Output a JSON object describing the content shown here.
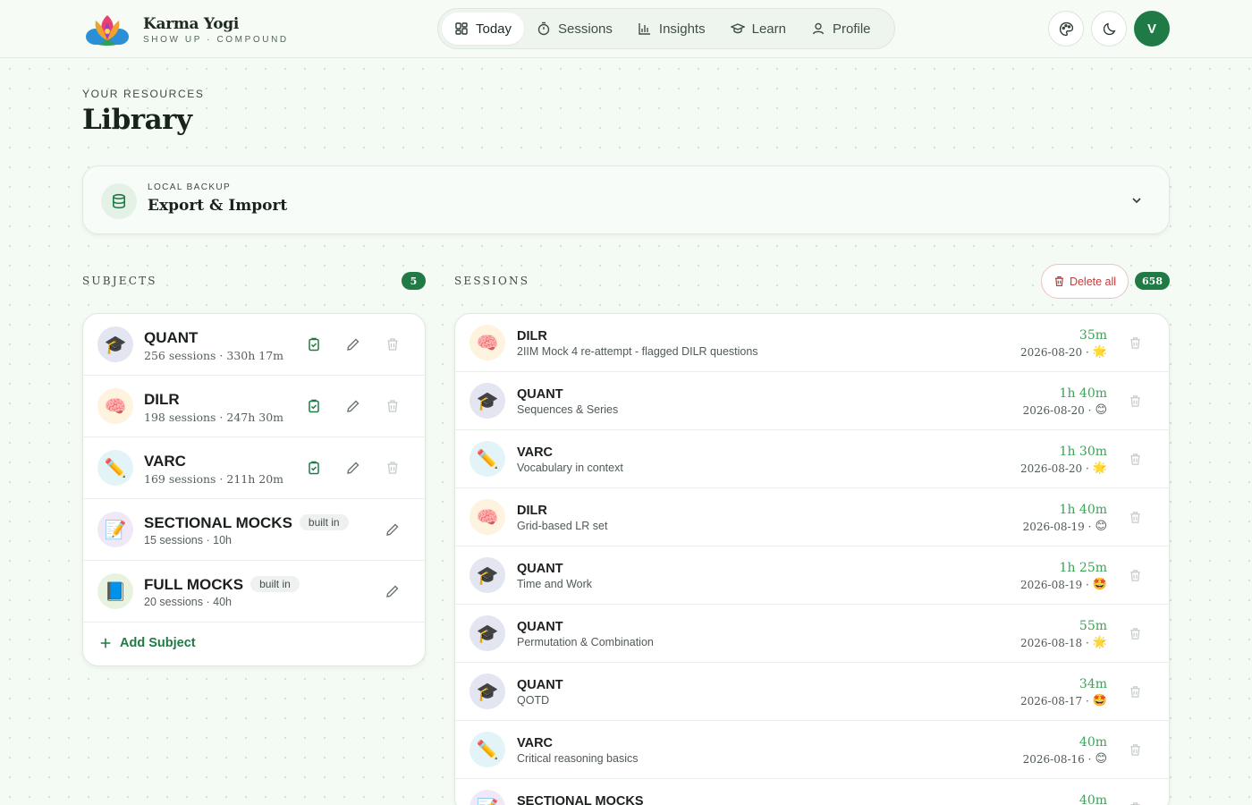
{
  "brand": {
    "name": "Karma Yogi",
    "tagline": "SHOW UP · COMPOUND"
  },
  "nav": {
    "items": [
      {
        "label": "Today",
        "icon": "grid-icon",
        "active": true
      },
      {
        "label": "Sessions",
        "icon": "timer-icon",
        "active": false
      },
      {
        "label": "Insights",
        "icon": "bar-chart-icon",
        "active": false
      },
      {
        "label": "Learn",
        "icon": "graduation-cap-icon",
        "active": false
      },
      {
        "label": "Profile",
        "icon": "user-icon",
        "active": false
      }
    ]
  },
  "toolbar": {
    "theme_icon": "palette-icon",
    "mode_icon": "moon-icon",
    "avatar_initial": "V"
  },
  "header": {
    "eyebrow": "YOUR RESOURCES",
    "title": "Library"
  },
  "backup": {
    "eyebrow": "LOCAL BACKUP",
    "title": "Export & Import"
  },
  "subjects": {
    "label": "SUBJECTS",
    "count": "5",
    "add_label": "Add Subject",
    "items": [
      {
        "name": "QUANT",
        "meta": "256 sessions · 330h 17m",
        "emoji": "🎓",
        "builtin": ""
      },
      {
        "name": "DILR",
        "meta": "198 sessions · 247h 30m",
        "emoji": "🧠",
        "builtin": ""
      },
      {
        "name": "VARC",
        "meta": "169 sessions · 211h 20m",
        "emoji": "✏️",
        "builtin": ""
      },
      {
        "name": "SECTIONAL MOCKS",
        "meta": "15 sessions · 10h",
        "emoji": "📝",
        "builtin": "built in"
      },
      {
        "name": "FULL MOCKS",
        "meta": "20 sessions · 40h",
        "emoji": "📘",
        "builtin": "built in"
      }
    ]
  },
  "sessions": {
    "label": "SESSIONS",
    "count": "658",
    "delete_all_label": "Delete all",
    "items": [
      {
        "subject": "DILR",
        "topic": "2IIM Mock 4 re-attempt - flagged DILR questions",
        "duration": "35m",
        "date": "2026-08-20 ·",
        "mood": "🌟",
        "emoji": "🧠"
      },
      {
        "subject": "QUANT",
        "topic": "Sequences & Series",
        "duration": "1h 40m",
        "date": "2026-08-20 ·",
        "mood": "😊",
        "emoji": "🎓"
      },
      {
        "subject": "VARC",
        "topic": "Vocabulary in context",
        "duration": "1h 30m",
        "date": "2026-08-20 ·",
        "mood": "🌟",
        "emoji": "✏️"
      },
      {
        "subject": "DILR",
        "topic": "Grid-based LR set",
        "duration": "1h 40m",
        "date": "2026-08-19 ·",
        "mood": "😊",
        "emoji": "🧠"
      },
      {
        "subject": "QUANT",
        "topic": "Time and Work",
        "duration": "1h 25m",
        "date": "2026-08-19 ·",
        "mood": "🤩",
        "emoji": "🎓"
      },
      {
        "subject": "QUANT",
        "topic": "Permutation & Combination",
        "duration": "55m",
        "date": "2026-08-18 ·",
        "mood": "🌟",
        "emoji": "🎓"
      },
      {
        "subject": "QUANT",
        "topic": "QOTD",
        "duration": "34m",
        "date": "2026-08-17 ·",
        "mood": "🤩",
        "emoji": "🎓"
      },
      {
        "subject": "VARC",
        "topic": "Critical reasoning basics",
        "duration": "40m",
        "date": "2026-08-16 ·",
        "mood": "😊",
        "emoji": "✏️"
      },
      {
        "subject": "SECTIONAL MOCKS",
        "topic": "",
        "duration": "40m",
        "date": "",
        "mood": "",
        "emoji": "📝"
      }
    ]
  },
  "colors": {
    "brand_green": "#1f7a45",
    "duration_green": "#3aa457",
    "danger": "#c63a3a"
  }
}
